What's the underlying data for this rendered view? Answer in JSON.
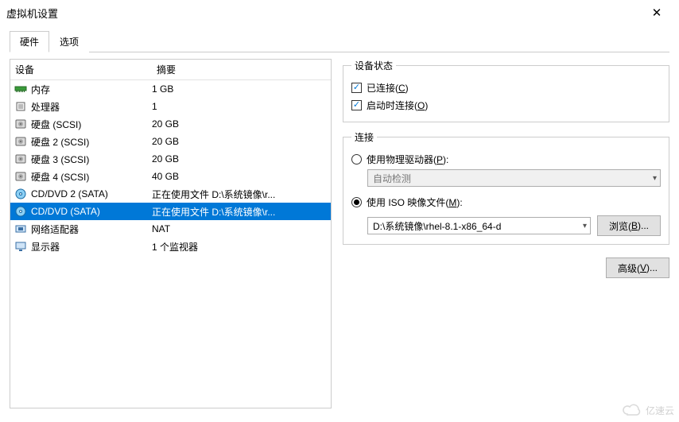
{
  "window": {
    "title": "虚拟机设置",
    "close_label": "✕"
  },
  "tabs": {
    "hardware": "硬件",
    "options": "选项"
  },
  "columns": {
    "device": "设备",
    "summary": "摘要"
  },
  "devices": [
    {
      "name": "内存",
      "summary": "1 GB",
      "icon": "memory"
    },
    {
      "name": "处理器",
      "summary": "1",
      "icon": "cpu"
    },
    {
      "name": "硬盘 (SCSI)",
      "summary": "20 GB",
      "icon": "disk"
    },
    {
      "name": "硬盘 2 (SCSI)",
      "summary": "20 GB",
      "icon": "disk"
    },
    {
      "name": "硬盘 3 (SCSI)",
      "summary": "20 GB",
      "icon": "disk"
    },
    {
      "name": "硬盘 4 (SCSI)",
      "summary": "40 GB",
      "icon": "disk"
    },
    {
      "name": "CD/DVD 2 (SATA)",
      "summary": "正在使用文件 D:\\系统镜像\\r...",
      "icon": "cd"
    },
    {
      "name": "CD/DVD (SATA)",
      "summary": "正在使用文件 D:\\系统镜像\\r...",
      "icon": "cd",
      "selected": true
    },
    {
      "name": "网络适配器",
      "summary": "NAT",
      "icon": "net"
    },
    {
      "name": "显示器",
      "summary": "1 个监视器",
      "icon": "display"
    }
  ],
  "status_group": {
    "legend": "设备状态",
    "connected": {
      "label": "已连接(",
      "hotkey": "C",
      "suffix": ")",
      "checked": true
    },
    "connect_at_power_on": {
      "label": "启动时连接(",
      "hotkey": "O",
      "suffix": ")",
      "checked": true
    }
  },
  "connection_group": {
    "legend": "连接",
    "physical": {
      "label": "使用物理驱动器(",
      "hotkey": "P",
      "suffix": "):",
      "checked": false
    },
    "physical_combo": "自动检测",
    "iso": {
      "label": "使用 ISO 映像文件(",
      "hotkey": "M",
      "suffix": "):",
      "checked": true
    },
    "iso_path": "D:\\系统镜像\\rhel-8.1-x86_64-d",
    "browse": {
      "label": "浏览(",
      "hotkey": "B",
      "suffix": ")..."
    }
  },
  "advanced_btn": {
    "label": "高级(",
    "hotkey": "V",
    "suffix": ")..."
  },
  "watermark": "亿速云"
}
